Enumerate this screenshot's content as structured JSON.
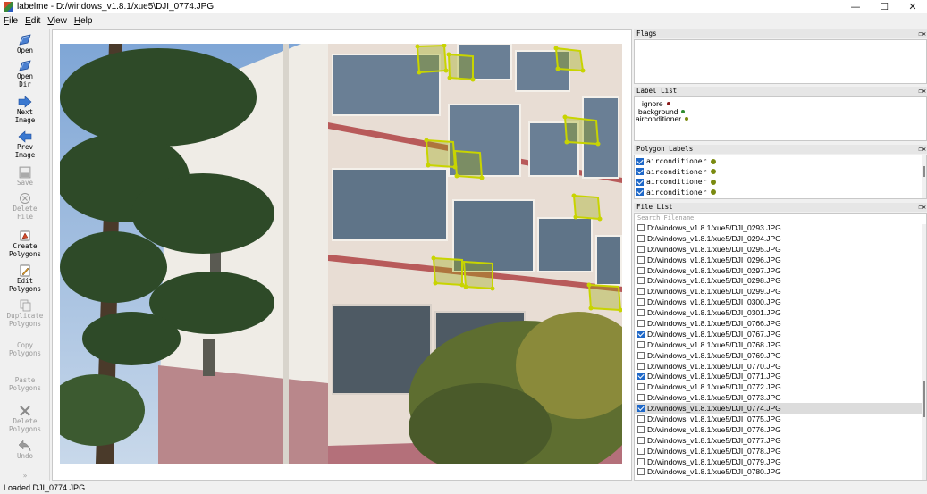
{
  "window": {
    "title": "labelme - D:/windows_v1.8.1/xue5\\DJI_0774.JPG",
    "controls": {
      "minimize": "—",
      "maximize": "☐",
      "close": "✕"
    }
  },
  "menu": [
    {
      "key": "F",
      "rest": "ile"
    },
    {
      "key": "E",
      "rest": "dit"
    },
    {
      "key": "V",
      "rest": "iew"
    },
    {
      "key": "H",
      "rest": "elp"
    }
  ],
  "toolbar": {
    "open": [
      "Open"
    ],
    "open_dir": [
      "Open",
      "Dir"
    ],
    "next_image": [
      "Next",
      "Image"
    ],
    "prev_image": [
      "Prev",
      "Image"
    ],
    "save": [
      "Save"
    ],
    "delete_file": [
      "Delete",
      "File"
    ],
    "create_polygons": [
      "Create",
      "Polygons"
    ],
    "edit_polygons": [
      "Edit",
      "Polygons"
    ],
    "duplicate_polygons": [
      "Duplicate",
      "Polygons"
    ],
    "copy_polygons": [
      "Copy",
      "Polygons"
    ],
    "paste_polygons": [
      "Paste",
      "Polygons"
    ],
    "delete_polygons": [
      "Delete",
      "Polygons"
    ],
    "undo": [
      "Undo"
    ]
  },
  "docks": {
    "flags": {
      "title": "Flags"
    },
    "label_list": {
      "title": "Label List",
      "items": [
        {
          "text": "ignore",
          "color": "#8b1a1a"
        },
        {
          "text": "background",
          "color": "#2e8b2e"
        },
        {
          "text": "airconditioner",
          "color": "#7a8a10"
        }
      ]
    },
    "polygon_labels": {
      "title": "Polygon Labels",
      "items": [
        {
          "text": "airconditioner",
          "checked": true,
          "color": "#7a8a10"
        },
        {
          "text": "airconditioner",
          "checked": true,
          "color": "#7a8a10"
        },
        {
          "text": "airconditioner",
          "checked": true,
          "color": "#7a8a10"
        },
        {
          "text": "airconditioner",
          "checked": true,
          "color": "#7a8a10"
        }
      ]
    },
    "file_list": {
      "title": "File List",
      "search_placeholder": "Search Filename",
      "files": [
        {
          "name": "D:/windows_v1.8.1/xue5/DJI_0293.JPG",
          "checked": false,
          "selected": false
        },
        {
          "name": "D:/windows_v1.8.1/xue5/DJI_0294.JPG",
          "checked": false,
          "selected": false
        },
        {
          "name": "D:/windows_v1.8.1/xue5/DJI_0295.JPG",
          "checked": false,
          "selected": false
        },
        {
          "name": "D:/windows_v1.8.1/xue5/DJI_0296.JPG",
          "checked": false,
          "selected": false
        },
        {
          "name": "D:/windows_v1.8.1/xue5/DJI_0297.JPG",
          "checked": false,
          "selected": false
        },
        {
          "name": "D:/windows_v1.8.1/xue5/DJI_0298.JPG",
          "checked": false,
          "selected": false
        },
        {
          "name": "D:/windows_v1.8.1/xue5/DJI_0299.JPG",
          "checked": false,
          "selected": false
        },
        {
          "name": "D:/windows_v1.8.1/xue5/DJI_0300.JPG",
          "checked": false,
          "selected": false
        },
        {
          "name": "D:/windows_v1.8.1/xue5/DJI_0301.JPG",
          "checked": false,
          "selected": false
        },
        {
          "name": "D:/windows_v1.8.1/xue5/DJI_0766.JPG",
          "checked": false,
          "selected": false
        },
        {
          "name": "D:/windows_v1.8.1/xue5/DJI_0767.JPG",
          "checked": true,
          "selected": false
        },
        {
          "name": "D:/windows_v1.8.1/xue5/DJI_0768.JPG",
          "checked": false,
          "selected": false
        },
        {
          "name": "D:/windows_v1.8.1/xue5/DJI_0769.JPG",
          "checked": false,
          "selected": false
        },
        {
          "name": "D:/windows_v1.8.1/xue5/DJI_0770.JPG",
          "checked": false,
          "selected": false
        },
        {
          "name": "D:/windows_v1.8.1/xue5/DJI_0771.JPG",
          "checked": true,
          "selected": false
        },
        {
          "name": "D:/windows_v1.8.1/xue5/DJI_0772.JPG",
          "checked": false,
          "selected": false
        },
        {
          "name": "D:/windows_v1.8.1/xue5/DJI_0773.JPG",
          "checked": false,
          "selected": false
        },
        {
          "name": "D:/windows_v1.8.1/xue5/DJI_0774.JPG",
          "checked": true,
          "selected": true
        },
        {
          "name": "D:/windows_v1.8.1/xue5/DJI_0775.JPG",
          "checked": false,
          "selected": false
        },
        {
          "name": "D:/windows_v1.8.1/xue5/DJI_0776.JPG",
          "checked": false,
          "selected": false
        },
        {
          "name": "D:/windows_v1.8.1/xue5/DJI_0777.JPG",
          "checked": false,
          "selected": false
        },
        {
          "name": "D:/windows_v1.8.1/xue5/DJI_0778.JPG",
          "checked": false,
          "selected": false
        },
        {
          "name": "D:/windows_v1.8.1/xue5/DJI_0779.JPG",
          "checked": false,
          "selected": false
        },
        {
          "name": "D:/windows_v1.8.1/xue5/DJI_0780.JPG",
          "checked": false,
          "selected": false
        }
      ]
    }
  },
  "status": {
    "text": "Loaded DJI_0774.JPG"
  },
  "colors": {
    "polygon_outline": "#c8d400",
    "polygon_fill": "#9aa80a",
    "checkbox_checked": "#1f68c8"
  }
}
